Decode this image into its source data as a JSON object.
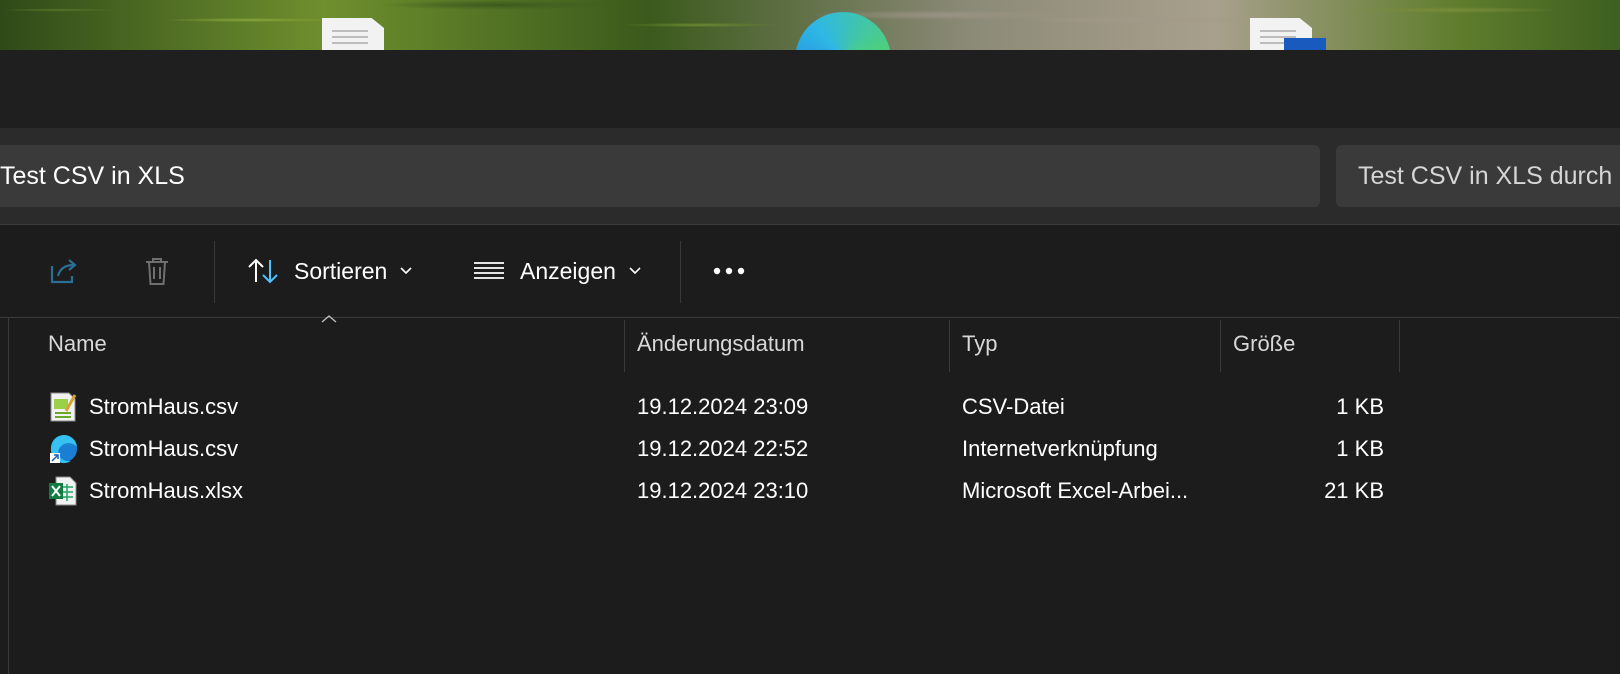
{
  "address": {
    "path": "Test CSV in XLS"
  },
  "search": {
    "placeholder": "Test CSV in XLS durch"
  },
  "toolbar": {
    "share_icon": "share-icon",
    "delete_icon": "trash-icon",
    "sort_label": "Sortieren",
    "view_label": "Anzeigen",
    "more_icon": "more-dots-icon"
  },
  "columns": {
    "name": "Name",
    "modified": "Änderungsdatum",
    "type": "Typ",
    "size": "Größe"
  },
  "files": [
    {
      "name": "StromHaus.csv",
      "modified": "19.12.2024 23:09",
      "type": "CSV-Datei",
      "size": "1 KB",
      "icon": "notepadpp-csv-icon"
    },
    {
      "name": "StromHaus.csv",
      "modified": "19.12.2024 22:52",
      "type": "Internetverknüpfung",
      "size": "1 KB",
      "icon": "edge-shortcut-icon"
    },
    {
      "name": "StromHaus.xlsx",
      "modified": "19.12.2024 23:10",
      "type": "Microsoft Excel-Arbei...",
      "size": "21 KB",
      "icon": "excel-icon"
    }
  ],
  "colors": {
    "background": "#1c1c1c",
    "address_bg": "#3a3a3a",
    "accent_blue": "#4cc2ff"
  }
}
